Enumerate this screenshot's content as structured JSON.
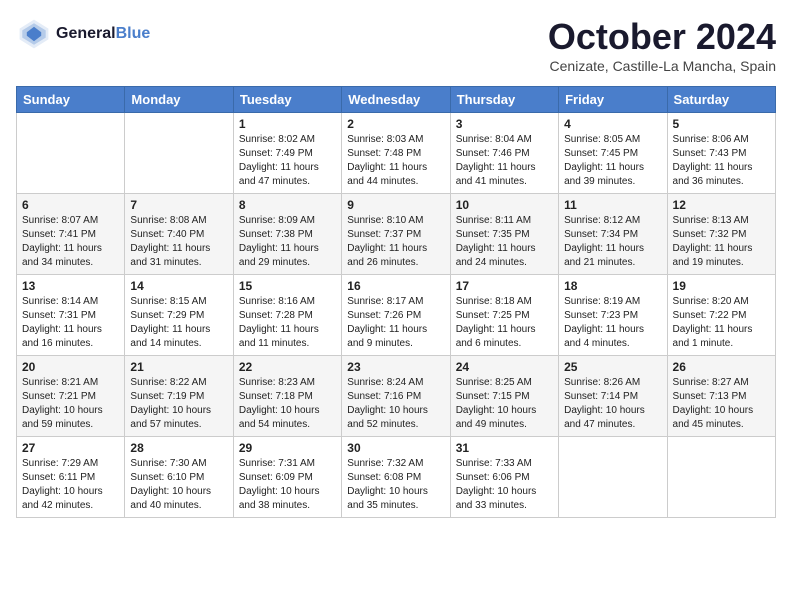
{
  "header": {
    "logo_line1": "General",
    "logo_line2": "Blue",
    "month": "October 2024",
    "location": "Cenizate, Castille-La Mancha, Spain"
  },
  "days_of_week": [
    "Sunday",
    "Monday",
    "Tuesday",
    "Wednesday",
    "Thursday",
    "Friday",
    "Saturday"
  ],
  "weeks": [
    [
      {
        "day": "",
        "info": ""
      },
      {
        "day": "",
        "info": ""
      },
      {
        "day": "1",
        "info": "Sunrise: 8:02 AM\nSunset: 7:49 PM\nDaylight: 11 hours and 47 minutes."
      },
      {
        "day": "2",
        "info": "Sunrise: 8:03 AM\nSunset: 7:48 PM\nDaylight: 11 hours and 44 minutes."
      },
      {
        "day": "3",
        "info": "Sunrise: 8:04 AM\nSunset: 7:46 PM\nDaylight: 11 hours and 41 minutes."
      },
      {
        "day": "4",
        "info": "Sunrise: 8:05 AM\nSunset: 7:45 PM\nDaylight: 11 hours and 39 minutes."
      },
      {
        "day": "5",
        "info": "Sunrise: 8:06 AM\nSunset: 7:43 PM\nDaylight: 11 hours and 36 minutes."
      }
    ],
    [
      {
        "day": "6",
        "info": "Sunrise: 8:07 AM\nSunset: 7:41 PM\nDaylight: 11 hours and 34 minutes."
      },
      {
        "day": "7",
        "info": "Sunrise: 8:08 AM\nSunset: 7:40 PM\nDaylight: 11 hours and 31 minutes."
      },
      {
        "day": "8",
        "info": "Sunrise: 8:09 AM\nSunset: 7:38 PM\nDaylight: 11 hours and 29 minutes."
      },
      {
        "day": "9",
        "info": "Sunrise: 8:10 AM\nSunset: 7:37 PM\nDaylight: 11 hours and 26 minutes."
      },
      {
        "day": "10",
        "info": "Sunrise: 8:11 AM\nSunset: 7:35 PM\nDaylight: 11 hours and 24 minutes."
      },
      {
        "day": "11",
        "info": "Sunrise: 8:12 AM\nSunset: 7:34 PM\nDaylight: 11 hours and 21 minutes."
      },
      {
        "day": "12",
        "info": "Sunrise: 8:13 AM\nSunset: 7:32 PM\nDaylight: 11 hours and 19 minutes."
      }
    ],
    [
      {
        "day": "13",
        "info": "Sunrise: 8:14 AM\nSunset: 7:31 PM\nDaylight: 11 hours and 16 minutes."
      },
      {
        "day": "14",
        "info": "Sunrise: 8:15 AM\nSunset: 7:29 PM\nDaylight: 11 hours and 14 minutes."
      },
      {
        "day": "15",
        "info": "Sunrise: 8:16 AM\nSunset: 7:28 PM\nDaylight: 11 hours and 11 minutes."
      },
      {
        "day": "16",
        "info": "Sunrise: 8:17 AM\nSunset: 7:26 PM\nDaylight: 11 hours and 9 minutes."
      },
      {
        "day": "17",
        "info": "Sunrise: 8:18 AM\nSunset: 7:25 PM\nDaylight: 11 hours and 6 minutes."
      },
      {
        "day": "18",
        "info": "Sunrise: 8:19 AM\nSunset: 7:23 PM\nDaylight: 11 hours and 4 minutes."
      },
      {
        "day": "19",
        "info": "Sunrise: 8:20 AM\nSunset: 7:22 PM\nDaylight: 11 hours and 1 minute."
      }
    ],
    [
      {
        "day": "20",
        "info": "Sunrise: 8:21 AM\nSunset: 7:21 PM\nDaylight: 10 hours and 59 minutes."
      },
      {
        "day": "21",
        "info": "Sunrise: 8:22 AM\nSunset: 7:19 PM\nDaylight: 10 hours and 57 minutes."
      },
      {
        "day": "22",
        "info": "Sunrise: 8:23 AM\nSunset: 7:18 PM\nDaylight: 10 hours and 54 minutes."
      },
      {
        "day": "23",
        "info": "Sunrise: 8:24 AM\nSunset: 7:16 PM\nDaylight: 10 hours and 52 minutes."
      },
      {
        "day": "24",
        "info": "Sunrise: 8:25 AM\nSunset: 7:15 PM\nDaylight: 10 hours and 49 minutes."
      },
      {
        "day": "25",
        "info": "Sunrise: 8:26 AM\nSunset: 7:14 PM\nDaylight: 10 hours and 47 minutes."
      },
      {
        "day": "26",
        "info": "Sunrise: 8:27 AM\nSunset: 7:13 PM\nDaylight: 10 hours and 45 minutes."
      }
    ],
    [
      {
        "day": "27",
        "info": "Sunrise: 7:29 AM\nSunset: 6:11 PM\nDaylight: 10 hours and 42 minutes."
      },
      {
        "day": "28",
        "info": "Sunrise: 7:30 AM\nSunset: 6:10 PM\nDaylight: 10 hours and 40 minutes."
      },
      {
        "day": "29",
        "info": "Sunrise: 7:31 AM\nSunset: 6:09 PM\nDaylight: 10 hours and 38 minutes."
      },
      {
        "day": "30",
        "info": "Sunrise: 7:32 AM\nSunset: 6:08 PM\nDaylight: 10 hours and 35 minutes."
      },
      {
        "day": "31",
        "info": "Sunrise: 7:33 AM\nSunset: 6:06 PM\nDaylight: 10 hours and 33 minutes."
      },
      {
        "day": "",
        "info": ""
      },
      {
        "day": "",
        "info": ""
      }
    ]
  ]
}
